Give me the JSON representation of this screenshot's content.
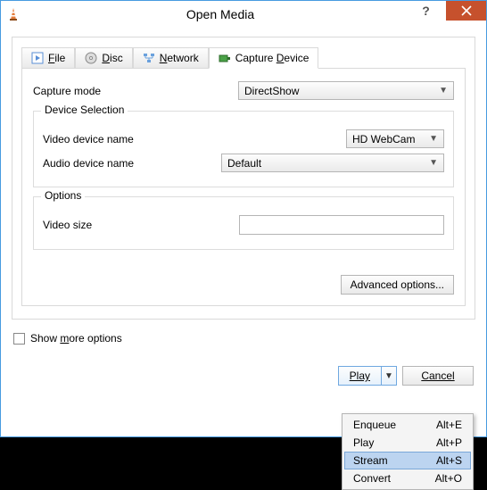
{
  "window": {
    "title": "Open Media"
  },
  "tabs": {
    "file": "File",
    "disc": "Disc",
    "network": "Network",
    "capture": "Capture Device"
  },
  "capture": {
    "mode_label": "Capture mode",
    "mode_value": "DirectShow",
    "device_selection_title": "Device Selection",
    "video_label": "Video device name",
    "video_value": "HD WebCam",
    "audio_label": "Audio device name",
    "audio_value": "Default",
    "options_title": "Options",
    "video_size_label": "Video size",
    "video_size_value": "",
    "advanced": "Advanced options..."
  },
  "show_more": "Show more options",
  "show_more_underlined_char": "m",
  "footer": {
    "play": "Play",
    "cancel": "Cancel"
  },
  "menu": {
    "enqueue": {
      "label": "Enqueue",
      "shortcut": "Alt+E"
    },
    "play": {
      "label": "Play",
      "shortcut": "Alt+P"
    },
    "stream": {
      "label": "Stream",
      "shortcut": "Alt+S"
    },
    "convert": {
      "label": "Convert",
      "shortcut": "Alt+O"
    }
  }
}
